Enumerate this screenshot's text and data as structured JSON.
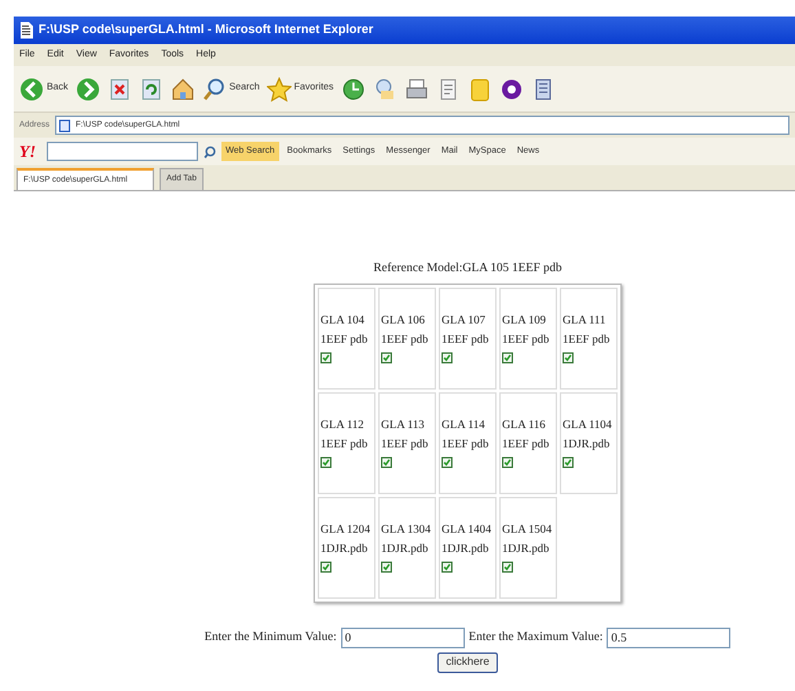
{
  "window": {
    "title": "F:\\USP code\\superGLA.html - Microsoft Internet Explorer"
  },
  "menu_bar": [
    "File",
    "Edit",
    "View",
    "Favorites",
    "Tools",
    "Help"
  ],
  "toolbar": [
    {
      "kind": "back",
      "label": "Back"
    },
    {
      "kind": "forward"
    },
    {
      "kind": "stop"
    },
    {
      "kind": "refresh"
    },
    {
      "kind": "home"
    },
    {
      "kind": "search",
      "label": "Search"
    },
    {
      "kind": "favorites",
      "label": "Favorites"
    },
    {
      "kind": "history"
    },
    {
      "kind": "mail"
    },
    {
      "kind": "print"
    },
    {
      "kind": "edit"
    },
    {
      "kind": "note"
    },
    {
      "kind": "messenger"
    },
    {
      "kind": "research"
    }
  ],
  "address_bar": {
    "label": "Address",
    "value": "F:\\USP code\\superGLA.html"
  },
  "yahoo_toolbar": {
    "logo": "Y!",
    "items": [
      {
        "kind": "highlight",
        "label": "Web Search"
      },
      {
        "kind": "plain",
        "label": "Bookmarks"
      },
      {
        "kind": "plain",
        "label": "Settings"
      },
      {
        "kind": "plain",
        "label": "Messenger"
      },
      {
        "kind": "plain",
        "label": "Mail"
      },
      {
        "kind": "plain",
        "label": "MySpace"
      },
      {
        "kind": "plain",
        "label": "News"
      }
    ]
  },
  "tabs": [
    {
      "label": "F:\\USP code\\superGLA.html",
      "selected": true
    },
    {
      "label": "Add Tab",
      "selected": false
    }
  ],
  "page": {
    "reference": "Reference Model:GLA 105 1EEF pdb",
    "cells": [
      {
        "label": "GLA 104 1EEF pdb",
        "checked": true
      },
      {
        "label": "GLA 106 1EEF pdb",
        "checked": true
      },
      {
        "label": "GLA 107 1EEF pdb",
        "checked": true
      },
      {
        "label": "GLA 109 1EEF pdb",
        "checked": true
      },
      {
        "label": "GLA 111 1EEF pdb",
        "checked": true
      },
      {
        "label": "GLA 112 1EEF pdb",
        "checked": true
      },
      {
        "label": "GLA 113 1EEF pdb",
        "checked": true
      },
      {
        "label": "GLA 114 1EEF pdb",
        "checked": true
      },
      {
        "label": "GLA 116 1EEF pdb",
        "checked": true
      },
      {
        "label": "GLA 1104 1DJR.pdb",
        "checked": true
      },
      {
        "label": "GLA 1204 1DJR.pdb",
        "checked": true
      },
      {
        "label": "GLA 1304 1DJR.pdb",
        "checked": true
      },
      {
        "label": "GLA 1404 1DJR.pdb",
        "checked": true
      },
      {
        "label": "GLA 1504 1DJR.pdb",
        "checked": true
      }
    ],
    "min_label": "Enter the Minimum Value:",
    "min_value": "0",
    "max_label": "Enter the Maximum Value:",
    "max_value": "0.5",
    "button": "clickhere"
  }
}
